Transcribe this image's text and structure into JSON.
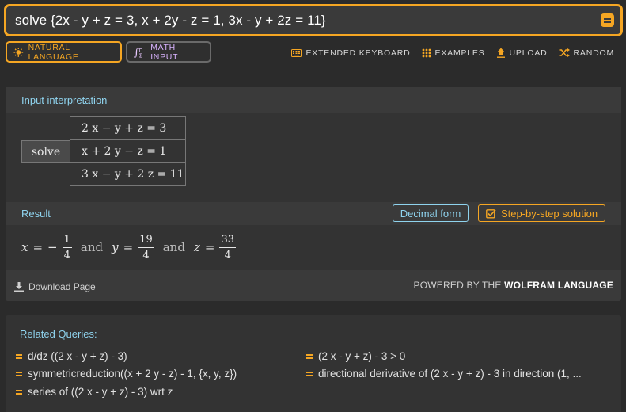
{
  "search": {
    "query": "solve {2x - y + z = 3, x + 2y - z = 1, 3x - y + 2z = 11}"
  },
  "modes": {
    "natural_language": "NATURAL LANGUAGE",
    "math_input": "MATH INPUT"
  },
  "toolbar": {
    "extended_keyboard": "EXTENDED KEYBOARD",
    "examples": "EXAMPLES",
    "upload": "UPLOAD",
    "random": "RANDOM"
  },
  "interpretation": {
    "title": "Input interpretation",
    "command": "solve",
    "equations": [
      "2 x − y + z = 3",
      "x + 2 y − z = 1",
      "3 x − y + 2 z = 11"
    ]
  },
  "result": {
    "title": "Result",
    "decimal_form": "Decimal form",
    "step_by_step": "Step-by-step solution",
    "conjunction": "and",
    "x": {
      "var": "x",
      "sign": "−",
      "num": "1",
      "den": "4"
    },
    "y": {
      "var": "y",
      "num": "19",
      "den": "4"
    },
    "z": {
      "var": "z",
      "num": "33",
      "den": "4"
    }
  },
  "footer": {
    "download": "Download Page",
    "powered_prefix": "POWERED BY THE ",
    "powered_brand": "WOLFRAM LANGUAGE"
  },
  "related": {
    "title": "Related Queries:",
    "items": [
      "d/dz ((2 x - y + z) - 3)",
      "(2 x - y + z) - 3 > 0",
      "symmetricreduction((x + 2 y - z) - 1, {x, y, z})",
      "directional derivative of (2 x - y + z) - 3 in direction (1, ...",
      "series of ((2 x - y + z) - 3) wrt z"
    ]
  },
  "colors": {
    "accent": "#f5a623",
    "link": "#8fd3ee",
    "background": "#2b2b2b"
  },
  "icons": [
    "search-go-icon",
    "sun-icon",
    "integral-icon",
    "keyboard-icon",
    "grid-icon",
    "upload-icon",
    "shuffle-icon",
    "checkbox-icon",
    "download-icon",
    "equals-icon"
  ]
}
